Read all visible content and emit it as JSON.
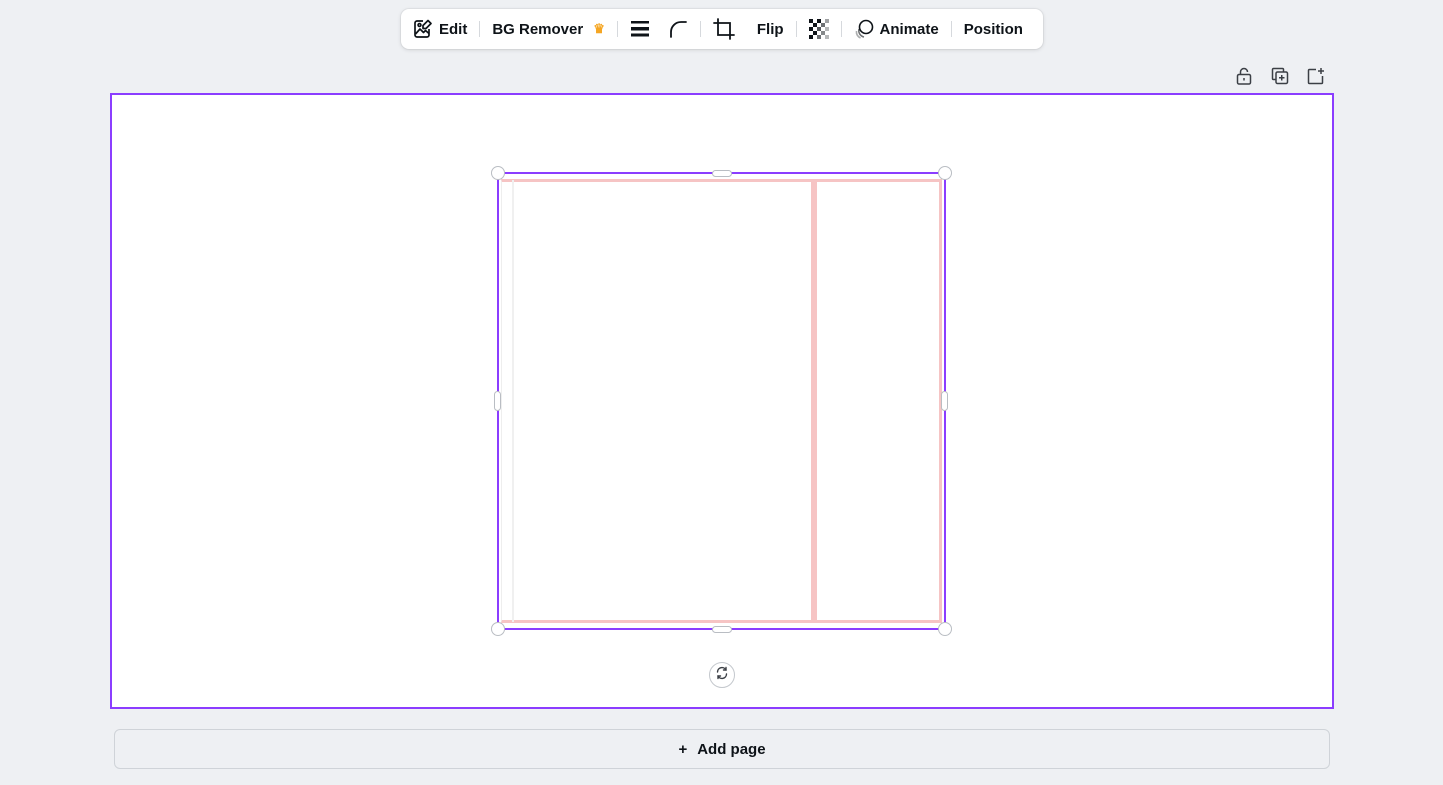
{
  "toolbar": {
    "edit_label": "Edit",
    "bg_remover_label": "BG Remover",
    "flip_label": "Flip",
    "animate_label": "Animate",
    "position_label": "Position",
    "icons": [
      "edit-image-icon",
      "crown-icon",
      "border-style-icon",
      "corner-rounding-icon",
      "crop-icon",
      "transparency-icon",
      "animate-icon"
    ]
  },
  "page_actions": {
    "icons": [
      "lock-icon",
      "duplicate-page-icon",
      "add-page-icon"
    ]
  },
  "canvas": {
    "accent_color": "#8b3dff",
    "frame_color": "#f6c4c4"
  },
  "add_page": {
    "plus": "+",
    "label": "Add page"
  }
}
